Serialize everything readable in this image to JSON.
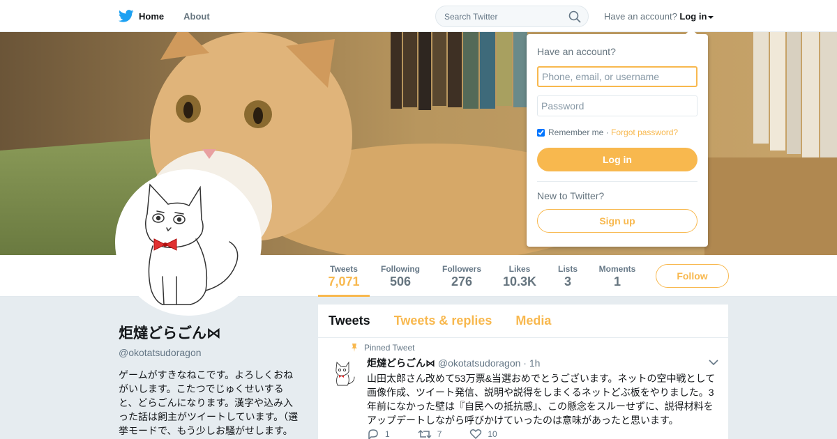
{
  "nav": {
    "home_label": "Home",
    "about_label": "About",
    "search_placeholder": "Search Twitter",
    "have_account_text": "Have an account?",
    "login_label": "Log in"
  },
  "login_dropdown": {
    "title": "Have an account?",
    "username_placeholder": "Phone, email, or username",
    "password_placeholder": "Password",
    "remember_label": "Remember me",
    "separator": "·",
    "forgot_label": "Forgot password?",
    "login_button": "Log in",
    "new_text": "New to Twitter?",
    "signup_button": "Sign up"
  },
  "stats": [
    {
      "label": "Tweets",
      "value": "7,071"
    },
    {
      "label": "Following",
      "value": "506"
    },
    {
      "label": "Followers",
      "value": "276"
    },
    {
      "label": "Likes",
      "value": "10.3K"
    },
    {
      "label": "Lists",
      "value": "3"
    },
    {
      "label": "Moments",
      "value": "1"
    }
  ],
  "follow_button": "Follow",
  "profile": {
    "name": "炬燵どらごん⋈",
    "handle": "@okotatsudoragon",
    "bio": "ゲームがすきなねこです。よろしくおねがいします。こたつでじゅくせいすると、どらごんになります。漢字や込み入った話は飼主がツイートしています。（選挙モードで、もう少しお騒がせします。声明の白山↓山田太郎↓支持）"
  },
  "timeline": {
    "tabs": [
      "Tweets",
      "Tweets & replies",
      "Media"
    ],
    "tweet": {
      "pinned_label": "Pinned Tweet",
      "author_name": "炬燵どらごん⋈",
      "author_handle": "@okotatsudoragon",
      "separator": "·",
      "time": "1h",
      "text": "山田太郎さん改めて53万票&当選おめでとうございます。ネットの空中戦として画像作成、ツイート発信、説明や説得をしまくるネットどぶ板をやりました。3年前になかった壁は『自民への抵抗感』、この懸念をスルーせずに、説得材料をアップデートしながら呼びかけていったのは意味があったと思います。",
      "reply_count": "1",
      "retweet_count": "7",
      "like_count": "10"
    }
  },
  "colors": {
    "accent": "#f8b84e",
    "twitter_blue": "#1da1f2",
    "secondary_text": "#657786",
    "page_background": "#e6ecf0"
  }
}
